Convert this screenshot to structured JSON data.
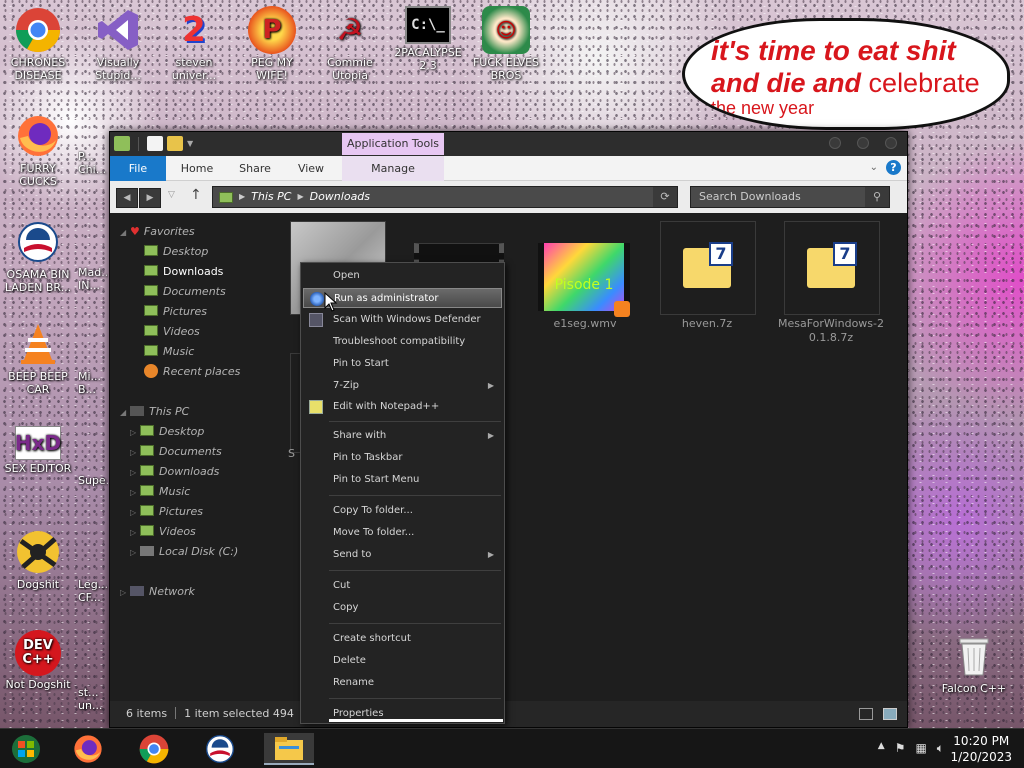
{
  "desktop": {
    "icons_left": [
      {
        "label": "CHRONES DISEASE",
        "icon": "chrome-icon"
      },
      {
        "label": "FURRY CUCKS",
        "icon": "firefox-icon"
      },
      {
        "label": "OSAMA BIN LADEN BR...",
        "icon": "obama-logo-icon"
      },
      {
        "label": "BEEP BEEP CAR",
        "icon": "vlc-cone-icon"
      },
      {
        "label": "SEX EDITOR",
        "icon": "hxd-icon"
      },
      {
        "label": "Dogshit",
        "icon": "codeblocks-icon"
      },
      {
        "label": "Not Dogshit",
        "icon": "devcpp-icon"
      }
    ],
    "icons_top": [
      {
        "label": "Visually Stupid...",
        "icon": "visual-studio-icon"
      },
      {
        "label": "steven univer...",
        "icon": "steven-universe-icon"
      },
      {
        "label": "PEG MY WIFE!",
        "icon": "peggle-icon"
      },
      {
        "label": "Commie Utopia",
        "icon": "commie-icon"
      },
      {
        "label": "2PACALYPSE 2.3",
        "icon": "cmd-icon"
      },
      {
        "label": "FUCK ELVES BROS",
        "icon": "elves-icon"
      }
    ],
    "partial_icons": [
      {
        "label": "P... Chi...",
        "icon": "partial-icon"
      },
      {
        "label": "Mad... IN...",
        "icon": "partial-icon"
      },
      {
        "label": "Mi... B...",
        "icon": "partial-icon"
      },
      {
        "label": "Supe...",
        "icon": "partial-icon"
      },
      {
        "label": "Leg... CF...",
        "icon": "partial-icon"
      },
      {
        "label": "st... un...",
        "icon": "partial-icon"
      }
    ],
    "recycle_bin": {
      "label": "Falcon C++",
      "icon": "recycle-bin-icon"
    },
    "bubble": {
      "line1": "it's time to eat shit",
      "line2_bold": "and die and",
      "line2_rest": "celebrate",
      "line3": "the new year"
    }
  },
  "window": {
    "contextual_tab": "Application Tools",
    "ribbon_tabs": [
      "File",
      "Home",
      "Share",
      "View",
      "Manage"
    ],
    "address": {
      "root": "This PC",
      "folder": "Downloads"
    },
    "search_placeholder": "Search Downloads",
    "nav": {
      "favorites": "Favorites",
      "favorites_items": [
        "Desktop",
        "Downloads",
        "Documents",
        "Pictures",
        "Videos",
        "Music",
        "Recent places"
      ],
      "this_pc": "This PC",
      "pc_items": [
        "Desktop",
        "Documents",
        "Downloads",
        "Music",
        "Pictures",
        "Videos",
        "Local Disk (C:)"
      ],
      "network": "Network"
    },
    "files": [
      {
        "name": "e1seg.wmv",
        "thumb_text": "Pisode 1"
      },
      {
        "name": "heven.7z",
        "thumb_text": "7"
      },
      {
        "name": "MesaForWindows-20.1.8.7z",
        "thumb_text": "7"
      }
    ],
    "partial_file_label": "S",
    "status": {
      "items": "6 items",
      "selected": "1 item selected",
      "size": "494"
    }
  },
  "context_menu": {
    "items": [
      {
        "label": "Open"
      },
      {
        "label": "Run as administrator",
        "highlighted": true
      },
      {
        "label": "Scan With Windows Defender"
      },
      {
        "label": "Troubleshoot compatibility"
      },
      {
        "label": "Pin to Start"
      },
      {
        "label": "7-Zip",
        "submenu": true
      },
      {
        "label": "Edit with Notepad++"
      },
      {
        "label": "Share with",
        "submenu": true
      },
      {
        "label": "Pin to Taskbar"
      },
      {
        "label": "Pin to Start Menu"
      },
      {
        "label": "Copy To folder..."
      },
      {
        "label": "Move To folder..."
      },
      {
        "label": "Send to",
        "submenu": true
      },
      {
        "label": "Cut"
      },
      {
        "label": "Copy"
      },
      {
        "label": "Create shortcut"
      },
      {
        "label": "Delete"
      },
      {
        "label": "Rename"
      },
      {
        "label": "Properties"
      }
    ]
  },
  "taskbar": {
    "apps": [
      "start-orb-icon",
      "firefox-icon",
      "chrome-icon",
      "obama-logo-icon",
      "file-explorer-icon"
    ],
    "time": "10:20 PM",
    "date": "1/20/2023"
  },
  "colors": {
    "accent": "#1979ca",
    "contextual_tab": "#e7c7f2",
    "bubble_text": "#d8161c"
  }
}
